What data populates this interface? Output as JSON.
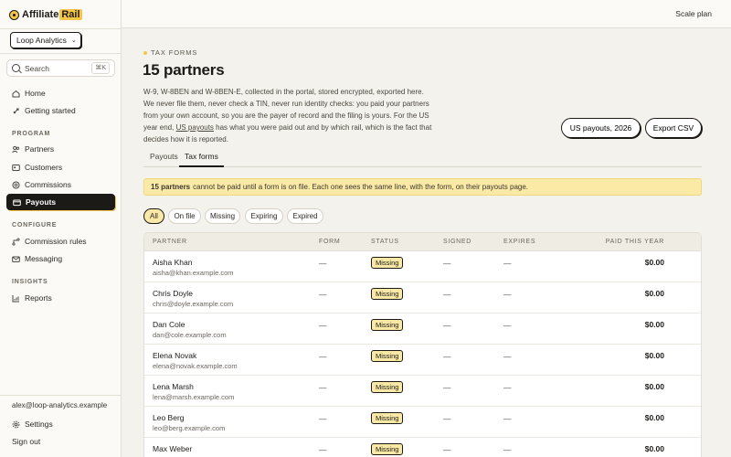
{
  "brand": {
    "name_a": "Affiliate",
    "name_b": "Rail"
  },
  "workspace": {
    "label": "Loop Analytics"
  },
  "search": {
    "label": "Search",
    "shortcut": "⌘K"
  },
  "nav": {
    "home": "Home",
    "getting_started": "Getting started",
    "program_label": "PROGRAM",
    "partners": "Partners",
    "customers": "Customers",
    "commissions": "Commissions",
    "payouts": "Payouts",
    "configure_label": "CONFIGURE",
    "commission_rules": "Commission rules",
    "messaging": "Messaging",
    "insights_label": "INSIGHTS",
    "reports": "Reports"
  },
  "footer": {
    "email": "alex@loop-analytics.example",
    "settings": "Settings",
    "sign_out": "Sign out"
  },
  "topbar": {
    "plan": "Scale plan"
  },
  "page": {
    "eyebrow": "TAX FORMS",
    "title": "15 partners",
    "desc_a": "W-9, W-8BEN and W-8BEN-E, collected in the portal, stored encrypted, exported here. We never file them, never check a TIN, never run identity checks: you paid your partners from your own account, so you are the payer of record and the filing is yours. For the US year end, ",
    "desc_link": "US payouts",
    "desc_b": " has what you were paid out and by which rail, which is the fact that decides how it is reported."
  },
  "actions": {
    "us_payouts": "US payouts, 2026",
    "export_csv": "Export CSV"
  },
  "tabs": {
    "payouts": "Payouts",
    "tax_forms": "Tax forms"
  },
  "banner": {
    "bold": "15 partners",
    "text": "cannot be paid until a form is on file. Each one sees the same line, with the form, on their payouts page."
  },
  "filters": {
    "all": "All",
    "on_file": "On file",
    "missing": "Missing",
    "expiring": "Expiring",
    "expired": "Expired"
  },
  "table": {
    "headers": {
      "partner": "PARTNER",
      "form": "FORM",
      "status": "STATUS",
      "signed": "SIGNED",
      "expires": "EXPIRES",
      "paid": "PAID THIS YEAR"
    },
    "rows": [
      {
        "name": "Aisha Khan",
        "email": "aisha@khan.example.com",
        "form": "—",
        "status": "Missing",
        "signed": "—",
        "expires": "—",
        "paid": "$0.00"
      },
      {
        "name": "Chris Doyle",
        "email": "chris@doyle.example.com",
        "form": "—",
        "status": "Missing",
        "signed": "—",
        "expires": "—",
        "paid": "$0.00"
      },
      {
        "name": "Dan Cole",
        "email": "dan@cole.example.com",
        "form": "—",
        "status": "Missing",
        "signed": "—",
        "expires": "—",
        "paid": "$0.00"
      },
      {
        "name": "Elena Novak",
        "email": "elena@novak.example.com",
        "form": "—",
        "status": "Missing",
        "signed": "—",
        "expires": "—",
        "paid": "$0.00"
      },
      {
        "name": "Lena Marsh",
        "email": "lena@marsh.example.com",
        "form": "—",
        "status": "Missing",
        "signed": "—",
        "expires": "—",
        "paid": "$0.00"
      },
      {
        "name": "Leo Berg",
        "email": "leo@berg.example.com",
        "form": "—",
        "status": "Missing",
        "signed": "—",
        "expires": "—",
        "paid": "$0.00"
      },
      {
        "name": "Max Weber",
        "email": "",
        "form": "—",
        "status": "Missing",
        "signed": "—",
        "expires": "—",
        "paid": "$0.00"
      }
    ]
  },
  "icons": {
    "search": "search-icon",
    "home": "home-icon",
    "rocket": "rocket-icon",
    "partners": "users-icon",
    "customers": "id-card-icon",
    "commissions": "coins-icon",
    "payouts": "wallet-icon",
    "rules": "branch-icon",
    "messaging": "mail-icon",
    "reports": "chart-icon",
    "settings": "gear-icon",
    "signout": "logout-icon"
  },
  "colors": {
    "accent": "#f5c64a",
    "ink": "#1c1a17",
    "background": "#f4f2ec",
    "banner": "#fbeaa5"
  }
}
